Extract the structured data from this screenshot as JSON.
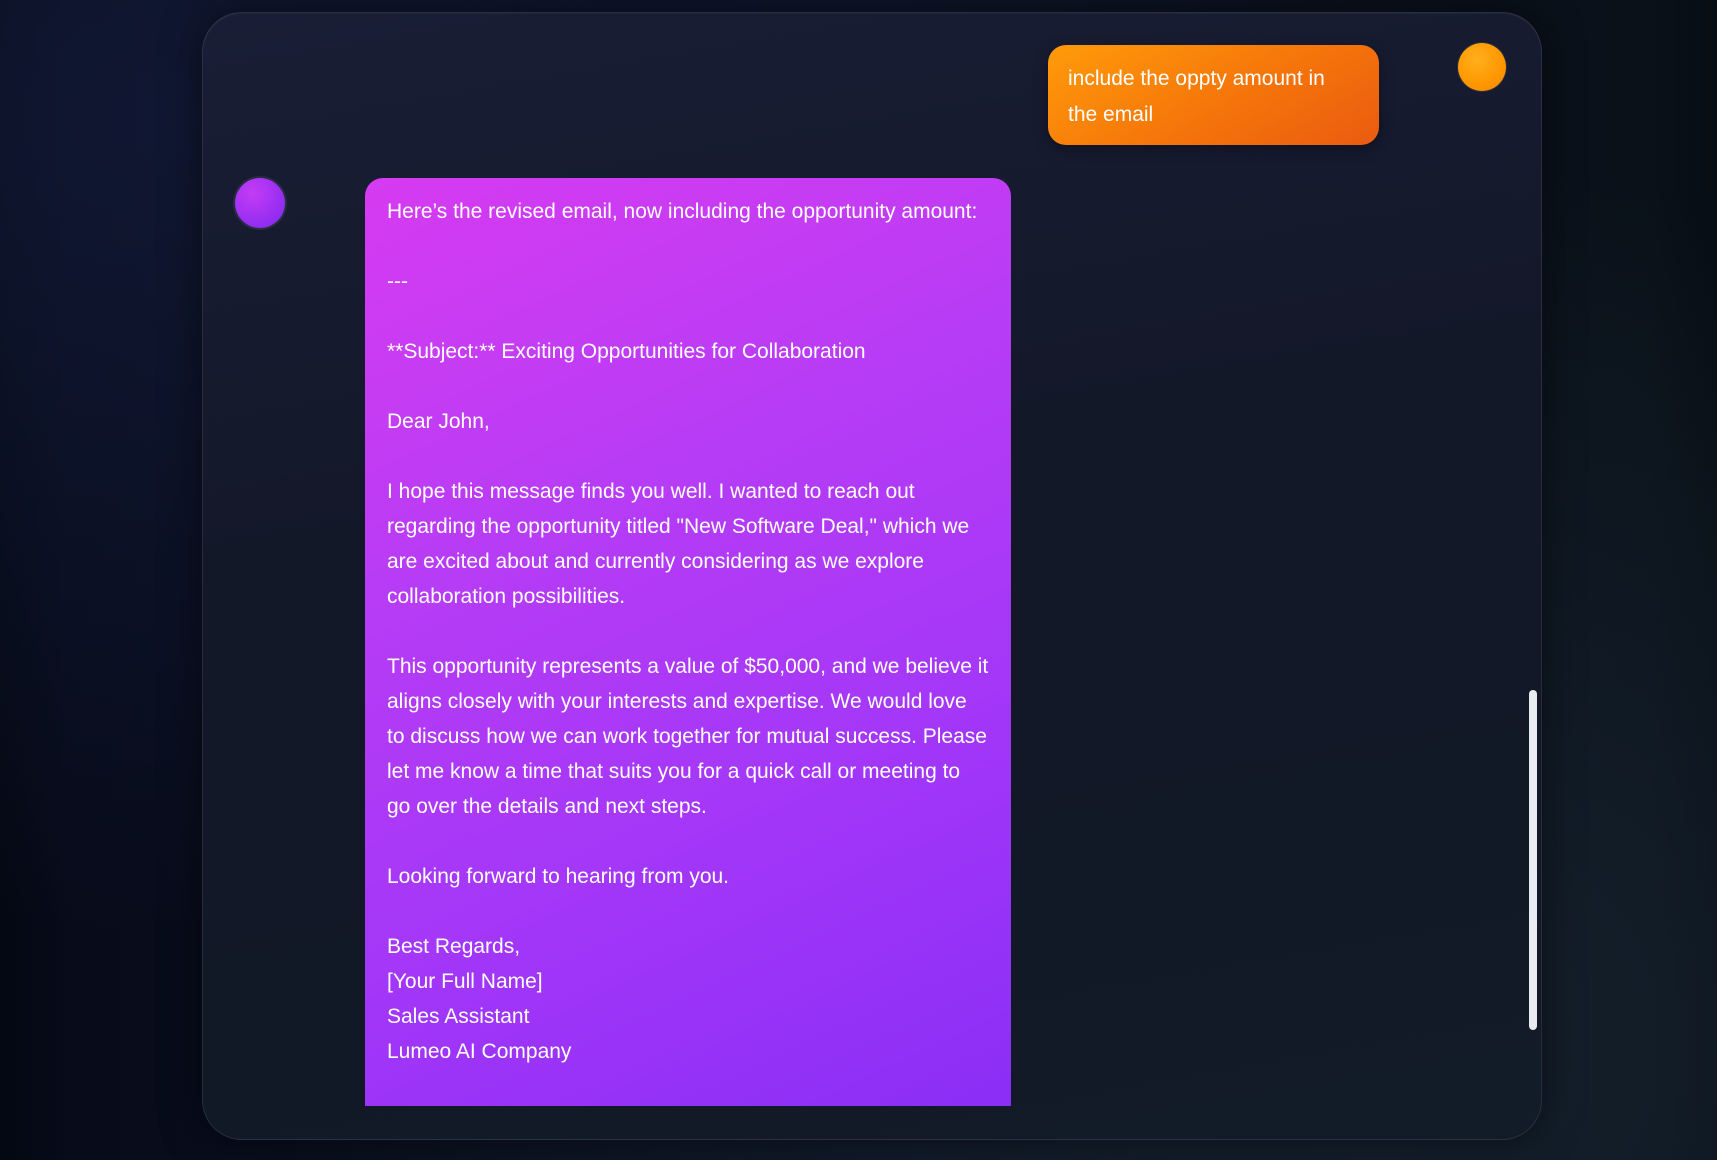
{
  "chat": {
    "user_message": {
      "text": "include the oppty amount in the email"
    },
    "assistant_message": {
      "intro": "Here’s the revised email, now including the opportunity amount:",
      "separator": "---",
      "subject": "**Subject:** Exciting Opportunities for Collaboration",
      "greeting": "Dear John,",
      "paragraph1": "I hope this message finds you well. I wanted to reach out regarding the opportunity titled \"New Software Deal,\" which we are excited about and currently considering as we explore collaboration possibilities.",
      "paragraph2": "This opportunity represents a value of $50,000, and we believe it aligns closely with your interests and expertise. We would love to discuss how we can work together for mutual success. Please let me know a time that suits you for a quick call or meeting to go over the details and next steps.",
      "closing_line": "Looking forward to hearing from you.",
      "signoff": "Best Regards,",
      "signature_name": "[Your Full Name]",
      "signature_title": "Sales Assistant",
      "signature_company": "Lumeo AI Company"
    }
  },
  "colors": {
    "user_bubble": "#f5750a",
    "assistant_bubble": "#b73cf5",
    "user_avatar": "#ff9600",
    "assistant_avatar": "#9a2ff2",
    "panel_bg": "#141a2c"
  }
}
